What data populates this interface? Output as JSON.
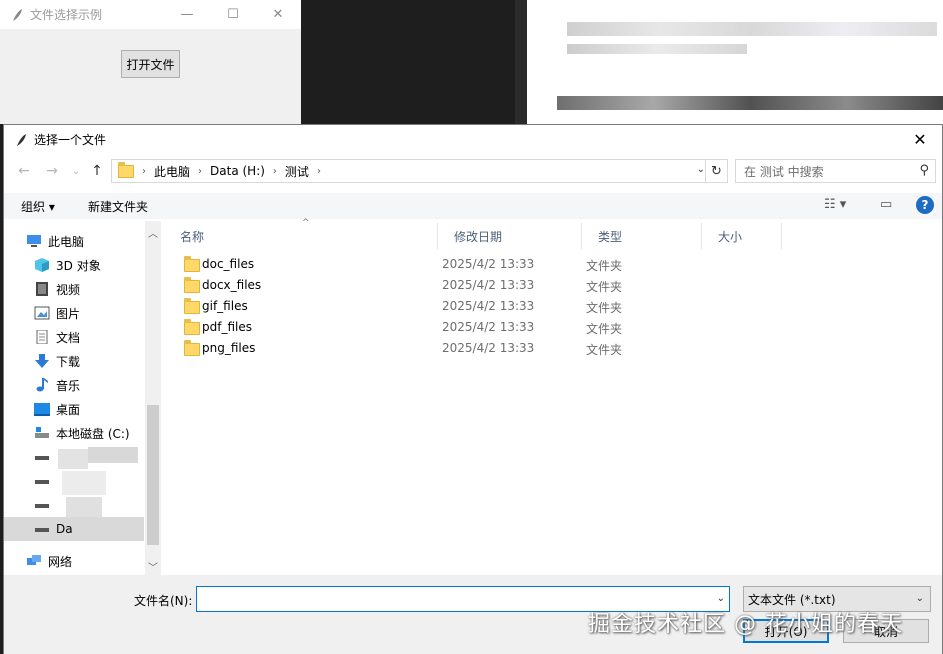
{
  "bg_window": {
    "title": "文件选择示例",
    "minimize": "—",
    "maximize": "☐",
    "close": "✕",
    "open_button": "打开文件"
  },
  "dialog": {
    "title": "选择一个文件",
    "close": "✕",
    "nav": {
      "back": "←",
      "forward": "→",
      "recent": "⌄",
      "up": "↑"
    },
    "breadcrumb": [
      "此电脑",
      "Data (H:)",
      "测试"
    ],
    "search_placeholder": "在 测试 中搜索",
    "toolbar": {
      "organize": "组织 ▾",
      "new_folder": "新建文件夹"
    },
    "nav_pane": [
      {
        "label": "此电脑",
        "icon": "computer-icon"
      },
      {
        "label": "3D 对象",
        "icon": "cube-icon"
      },
      {
        "label": "视频",
        "icon": "video-icon"
      },
      {
        "label": "图片",
        "icon": "picture-icon"
      },
      {
        "label": "文档",
        "icon": "document-icon"
      },
      {
        "label": "下载",
        "icon": "download-icon"
      },
      {
        "label": "音乐",
        "icon": "music-icon"
      },
      {
        "label": "桌面",
        "icon": "desktop-icon"
      },
      {
        "label": "本地磁盘 (C:)",
        "icon": "drive-icon"
      },
      {
        "label": "",
        "icon": "drive-icon"
      },
      {
        "label": "",
        "icon": "drive-icon"
      },
      {
        "label": "",
        "icon": "drive-icon"
      },
      {
        "label": "Da",
        "icon": "drive-icon"
      },
      {
        "label": "网络",
        "icon": "network-icon"
      }
    ],
    "columns": [
      "名称",
      "修改日期",
      "类型",
      "大小"
    ],
    "files": [
      {
        "name": "doc_files",
        "date": "2025/4/2 13:33",
        "type": "文件夹"
      },
      {
        "name": "docx_files",
        "date": "2025/4/2 13:33",
        "type": "文件夹"
      },
      {
        "name": "gif_files",
        "date": "2025/4/2 13:33",
        "type": "文件夹"
      },
      {
        "name": "pdf_files",
        "date": "2025/4/2 13:33",
        "type": "文件夹"
      },
      {
        "name": "png_files",
        "date": "2025/4/2 13:33",
        "type": "文件夹"
      }
    ],
    "filename_label": "文件名(N):",
    "filename_value": "",
    "filter": "文本文件 (*.txt)",
    "open_button": "打开(O)",
    "cancel_button": "取消"
  },
  "watermark": "掘金技术社区 @ 花小姐的春天",
  "colors": {
    "accent": "#0078d7",
    "folder": "#ffd867",
    "help": "#1c6bc4"
  }
}
